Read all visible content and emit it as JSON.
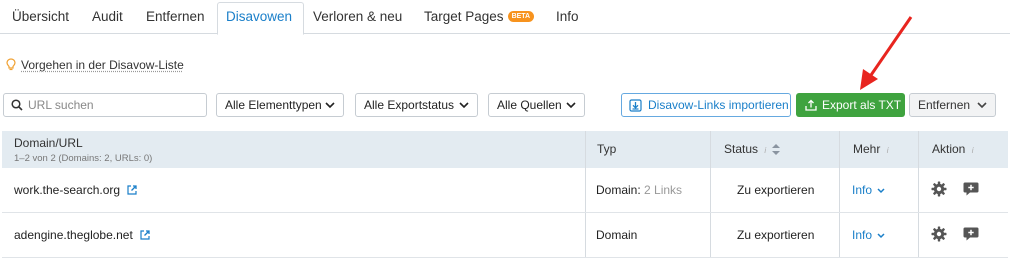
{
  "tabs": [
    {
      "label": "Übersicht"
    },
    {
      "label": "Audit"
    },
    {
      "label": "Entfernen"
    },
    {
      "label": "Disavowen",
      "active": true
    },
    {
      "label": "Verloren & neu"
    },
    {
      "label": "Target Pages",
      "badge": "BETA"
    },
    {
      "label": "Info"
    }
  ],
  "help_link": "Vorgehen in der Disavow-Liste",
  "search": {
    "placeholder": "URL suchen",
    "value": ""
  },
  "filters": {
    "element_types": "Alle Elementtypen",
    "export_status": "Alle Exportstatus",
    "sources": "Alle Quellen"
  },
  "actions": {
    "import": "Disavow-Links importieren",
    "export": "Export als TXT",
    "remove": "Entfernen"
  },
  "table": {
    "columns": {
      "domain": "Domain/URL",
      "domain_sub": "1–2 von 2 (Domains: 2, URLs: 0)",
      "type": "Typ",
      "status": "Status",
      "more": "Mehr",
      "action": "Aktion"
    },
    "rows": [
      {
        "domain": "work.the-search.org",
        "type": "Domain:",
        "type_extra": "2 Links",
        "status": "Zu exportieren",
        "more": "Info"
      },
      {
        "domain": "adengine.theglobe.net",
        "type": "Domain",
        "type_extra": "",
        "status": "Zu exportieren",
        "more": "Info"
      }
    ]
  },
  "colors": {
    "accent": "#1a7fc9",
    "export_green": "#3fa33f",
    "header_bg": "#e3ebf1",
    "annotation_red": "#e8251f",
    "beta_orange": "#f7931e"
  },
  "icons": [
    "lightbulb-icon",
    "search-icon",
    "chevron-down-icon",
    "import-icon",
    "export-icon",
    "external-link-icon",
    "gear-icon",
    "comment-plus-icon",
    "sort-icon",
    "info-icon"
  ]
}
